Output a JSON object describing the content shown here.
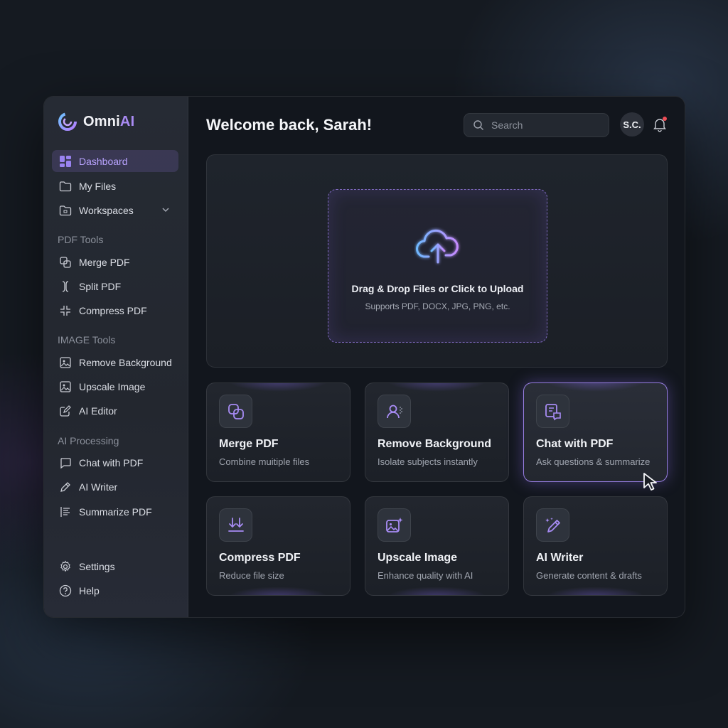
{
  "app": {
    "name_main": "Omni",
    "name_accent": "AI"
  },
  "sidebar": {
    "nav": [
      {
        "label": "Dashboard",
        "icon": "dashboard-icon"
      },
      {
        "label": "My Files",
        "icon": "folder-icon"
      },
      {
        "label": "Workspaces",
        "icon": "workspace-folder-icon"
      }
    ],
    "sections": [
      {
        "label": "PDF Tools",
        "items": [
          {
            "label": "Merge PDF",
            "icon": "merge-icon"
          },
          {
            "label": "Split PDF",
            "icon": "split-icon"
          },
          {
            "label": "Compress PDF",
            "icon": "compress-icon"
          }
        ]
      },
      {
        "label": "IMAGE Tools",
        "items": [
          {
            "label": "Remove Background",
            "icon": "image-icon"
          },
          {
            "label": "Upscale Image",
            "icon": "image-icon"
          },
          {
            "label": "AI Editor",
            "icon": "edit-icon"
          }
        ]
      },
      {
        "label": "AI Processing",
        "items": [
          {
            "label": "Chat with PDF",
            "icon": "chat-icon"
          },
          {
            "label": "AI Writer",
            "icon": "pen-icon"
          },
          {
            "label": "Summarize PDF",
            "icon": "summarize-icon"
          }
        ]
      }
    ],
    "footer": [
      {
        "label": "Settings",
        "icon": "gear-icon"
      },
      {
        "label": "Help",
        "icon": "help-icon"
      }
    ]
  },
  "header": {
    "title": "Welcome back, Sarah!",
    "search_placeholder": "Search",
    "avatar_initials": "S.C."
  },
  "upload": {
    "title": "Drag & Drop Files or Click to Upload",
    "subtitle": "Supports PDF, DOCX, JPG, PNG, etc."
  },
  "cards": [
    {
      "title": "Merge PDF",
      "subtitle": "Combine muitiple files",
      "icon": "merge-icon"
    },
    {
      "title": "Remove Background",
      "subtitle": "Isolate subjects instantly",
      "icon": "person-icon"
    },
    {
      "title": "Chat with PDF",
      "subtitle": "Ask questions & summarize",
      "icon": "chat-document-icon"
    },
    {
      "title": "Compress PDF",
      "subtitle": "Reduce file size",
      "icon": "compress-arrows-icon"
    },
    {
      "title": "Upscale Image",
      "subtitle": "Enhance quality with AI",
      "icon": "image-sparkle-icon"
    },
    {
      "title": "AI Writer",
      "subtitle": "Generate content & drafts",
      "icon": "pen-sparkle-icon"
    }
  ],
  "colors": {
    "accent": "#a98bf3",
    "active_nav_bg": "#3a3560",
    "notification_dot": "#ef4d56",
    "background": "#151a21"
  }
}
